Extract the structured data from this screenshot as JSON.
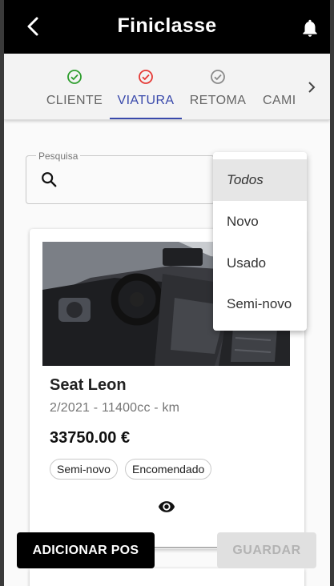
{
  "appbar": {
    "title": "Finiclasse"
  },
  "stepper": {
    "steps": [
      {
        "label": "CLIENTE",
        "status": "complete",
        "color": "#2e9e2e"
      },
      {
        "label": "VIATURA",
        "status": "error",
        "color": "#e53935"
      },
      {
        "label": "RETOMA",
        "status": "pending",
        "color": "#8a8a8a"
      },
      {
        "label": "CAMI",
        "status": "partial",
        "color": "#8a8a8a"
      }
    ],
    "accent": "#3949ab"
  },
  "search": {
    "label": "Pesquisa",
    "value": ""
  },
  "filter_menu": {
    "options": [
      "Todos",
      "Novo",
      "Usado",
      "Semi-novo"
    ],
    "selected": "Todos"
  },
  "vehicle": {
    "name": "Seat Leon",
    "details": "2/2021 - 11400cc - km",
    "price": "33750.00 €",
    "tags": [
      "Semi-novo",
      "Encomendado"
    ]
  },
  "actions": {
    "add_label": "ADICIONAR POS",
    "save_label": "GUARDAR"
  }
}
